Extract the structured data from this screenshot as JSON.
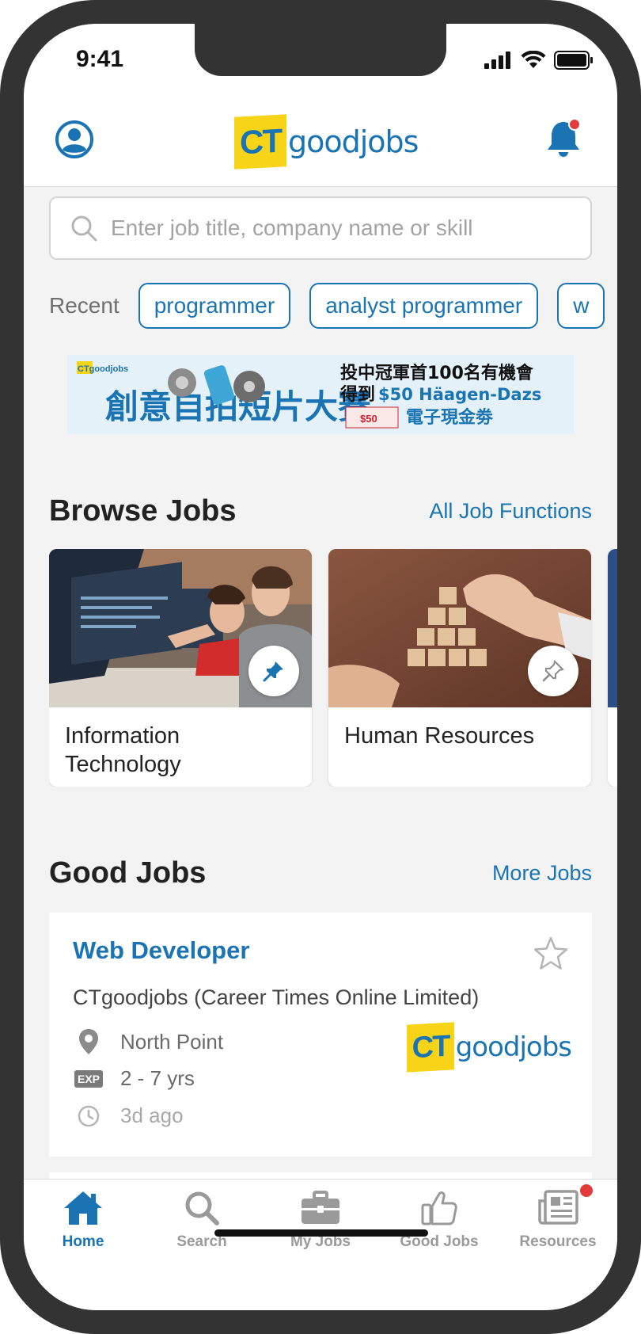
{
  "status_bar": {
    "time": "9:41"
  },
  "header": {
    "logo_ct": "CT",
    "logo_text": "goodjobs",
    "notification_dot_color": "#e23b3b"
  },
  "search": {
    "placeholder": "Enter job title, company name or skill"
  },
  "recent": {
    "label": "Recent",
    "chips": [
      "programmer",
      "analyst programmer",
      "w"
    ]
  },
  "banner": {
    "brand": "CTgoodjobs",
    "left_text": "創意自拍短片大賽",
    "right_line1": "投中冠軍首100名有機會",
    "right_line2_prefix": "得到",
    "right_line2_highlight": "$50 Häagen-Dazs",
    "right_line3": "電子現金劵",
    "voucher": "$50"
  },
  "browse_jobs": {
    "title": "Browse Jobs",
    "link": "All Job Functions",
    "cards": [
      {
        "title": "Information Technology",
        "pinned": true
      },
      {
        "title": "Human Resources",
        "pinned": false
      }
    ]
  },
  "good_jobs": {
    "title": "Good Jobs",
    "link": "More Jobs",
    "job": {
      "title": "Web Developer",
      "company": "CTgoodjobs (Career Times Online Limited)",
      "location": "North Point",
      "exp_badge": "EXP",
      "experience": "2 - 7 yrs",
      "posted": "3d ago",
      "logo_ct": "CT",
      "logo_text": "goodjobs"
    }
  },
  "tab_bar": {
    "tabs": [
      {
        "label": "Home",
        "icon": "home-icon",
        "active": true
      },
      {
        "label": "Search",
        "icon": "search-icon",
        "active": false
      },
      {
        "label": "My Jobs",
        "icon": "briefcase-icon",
        "active": false
      },
      {
        "label": "Good Jobs",
        "icon": "thumbs-up-icon",
        "active": false
      },
      {
        "label": "Resources",
        "icon": "newspaper-icon",
        "active": false,
        "badge": true
      }
    ]
  },
  "colors": {
    "brand_blue": "#1a74b4",
    "brand_yellow": "#f7d417",
    "badge_red": "#e23b3b"
  }
}
